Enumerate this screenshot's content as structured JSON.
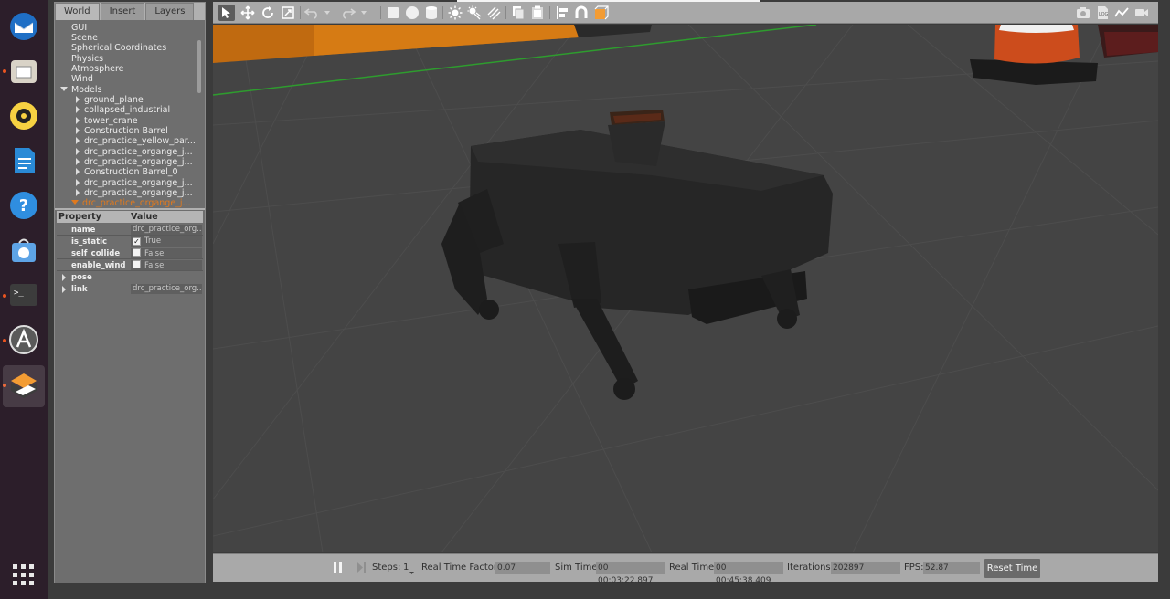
{
  "left_panel": {
    "tabs": [
      "World",
      "Insert",
      "Layers"
    ],
    "tree": {
      "top_items": [
        "GUI",
        "Scene",
        "Spherical Coordinates",
        "Physics",
        "Atmosphere",
        "Wind"
      ],
      "models_label": "Models",
      "models": [
        "ground_plane",
        "collapsed_industrial",
        "tower_crane",
        "Construction Barrel",
        "drc_practice_yellow_par...",
        "drc_practice_organge_j...",
        "drc_practice_organge_j...",
        "Construction Barrel_0",
        "drc_practice_organge_j...",
        "drc_practice_organge_j..."
      ],
      "selected_model": "drc_practice_organge_j..."
    },
    "properties": {
      "header_property": "Property",
      "header_value": "Value",
      "rows": [
        {
          "key": "name",
          "value": "drc_practice_org..."
        },
        {
          "key": "is_static",
          "value": "True",
          "checked": true
        },
        {
          "key": "self_collide",
          "value": "False",
          "checked": false
        },
        {
          "key": "enable_wind",
          "value": "False",
          "checked": false
        }
      ],
      "pose_label": "pose",
      "link_label": "link",
      "link_value": "drc_practice_org..."
    }
  },
  "statusbar": {
    "steps_label": "Steps:",
    "steps_value": "1",
    "rtf_label": "Real Time Factor:",
    "rtf_value": "0.07",
    "sim_time_label": "Sim Time:",
    "sim_time_value": "00 00:03:22.897",
    "real_time_label": "Real Time:",
    "real_time_value": "00 00:45:38.409",
    "iterations_label": "Iterations:",
    "iterations_value": "202897",
    "fps_label": "FPS:",
    "fps_value": "52.87",
    "reset_label": "Reset Time"
  },
  "colors": {
    "selected_orange": "#e07a1f",
    "ubuntu_accent": "#e95420"
  }
}
